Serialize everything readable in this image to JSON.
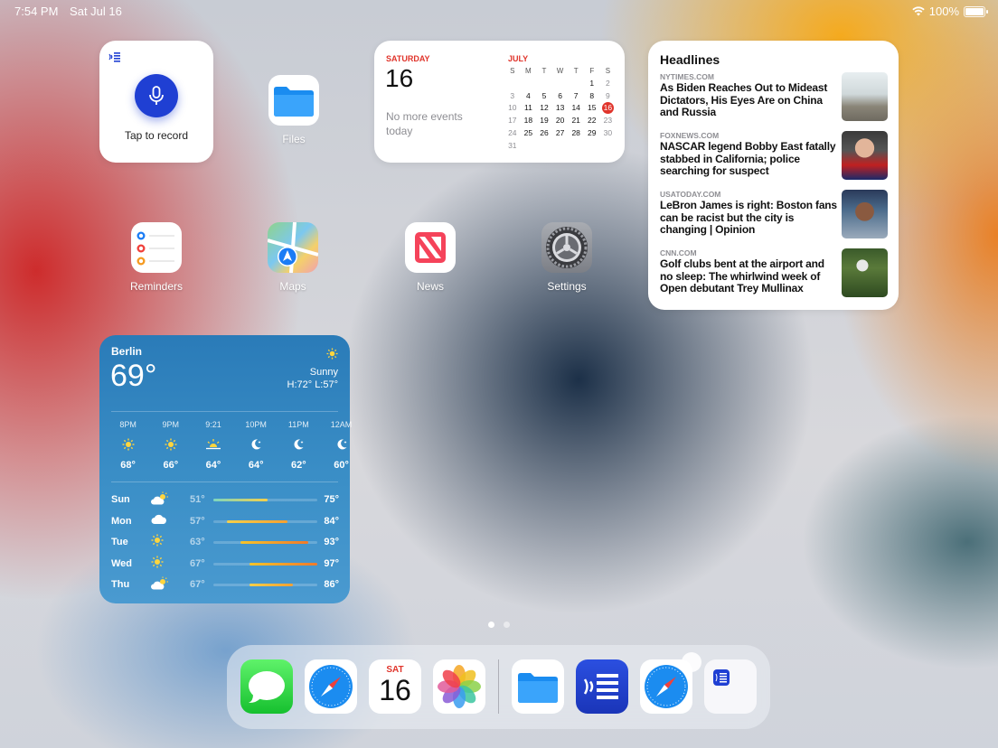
{
  "status": {
    "time": "7:54 PM",
    "date": "Sat Jul 16",
    "battery": "100%"
  },
  "voice_widget": {
    "label": "Tap to record"
  },
  "apps": {
    "files": "Files",
    "reminders": "Reminders",
    "maps": "Maps",
    "news": "News",
    "settings": "Settings"
  },
  "calendar": {
    "weekday": "SATURDAY",
    "day": "16",
    "no_events": "No more events today",
    "month": "JULY",
    "headers": [
      "S",
      "M",
      "T",
      "W",
      "T",
      "F",
      "S"
    ],
    "weeks": [
      [
        "",
        "",
        "",
        "",
        "",
        "1",
        "2"
      ],
      [
        "3",
        "4",
        "5",
        "6",
        "7",
        "8",
        "9"
      ],
      [
        "10",
        "11",
        "12",
        "13",
        "14",
        "15",
        "16"
      ],
      [
        "17",
        "18",
        "19",
        "20",
        "21",
        "22",
        "23"
      ],
      [
        "24",
        "25",
        "26",
        "27",
        "28",
        "29",
        "30"
      ],
      [
        "31",
        "",
        "",
        "",
        "",
        "",
        ""
      ]
    ],
    "today": "16"
  },
  "headlines": {
    "title": "Headlines",
    "items": [
      {
        "source": "NYTIMES.COM",
        "title": "As Biden Reaches Out to Mideast Dictators, His Eyes Are on China and Russia"
      },
      {
        "source": "FOXNEWS.COM",
        "title": "NASCAR legend Bobby East fatally stabbed in California; police searching for suspect"
      },
      {
        "source": "USATODAY.COM",
        "title": "LeBron James is right: Boston fans can be racist but the city is changing | Opinion"
      },
      {
        "source": "CNN.COM",
        "title": "Golf clubs bent at the airport and no sleep: The whirlwind week of Open debutant Trey Mullinax"
      }
    ]
  },
  "weather": {
    "city": "Berlin",
    "temp": "69°",
    "condition": "Sunny",
    "hilo": "H:72° L:57°",
    "hourly": [
      {
        "time": "8PM",
        "icon": "sun-icon",
        "temp": "68°"
      },
      {
        "time": "9PM",
        "icon": "sun-icon",
        "temp": "66°"
      },
      {
        "time": "9:21",
        "icon": "sunset-icon",
        "temp": "64°"
      },
      {
        "time": "10PM",
        "icon": "moon-icon",
        "temp": "64°"
      },
      {
        "time": "11PM",
        "icon": "moon-icon",
        "temp": "62°"
      },
      {
        "time": "12AM",
        "icon": "moon-icon",
        "temp": "60°"
      }
    ],
    "daily": [
      {
        "day": "Sun",
        "icon": "partly-cloudy-icon",
        "lo": "51°",
        "hi": "75°"
      },
      {
        "day": "Mon",
        "icon": "cloud-icon",
        "lo": "57°",
        "hi": "84°"
      },
      {
        "day": "Tue",
        "icon": "sun-icon",
        "lo": "63°",
        "hi": "93°"
      },
      {
        "day": "Wed",
        "icon": "sun-icon",
        "lo": "67°",
        "hi": "97°"
      },
      {
        "day": "Thu",
        "icon": "partly-cloudy-icon",
        "lo": "67°",
        "hi": "86°"
      }
    ]
  },
  "dock": {
    "calendar_day": "SAT",
    "calendar_num": "16",
    "apps": [
      "messages-icon",
      "safari-icon",
      "calendar-icon",
      "photos-icon",
      "files-icon",
      "voice-app-icon",
      "safari-icon",
      "app-library-icon"
    ]
  }
}
